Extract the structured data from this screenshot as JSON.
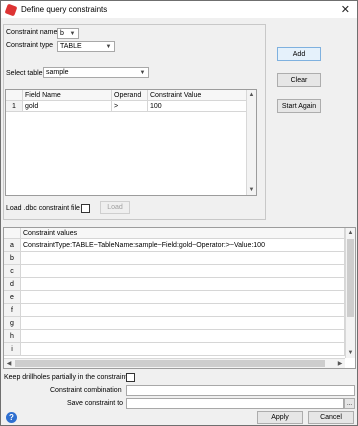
{
  "window": {
    "title": "Define query constraints",
    "close_glyph": "✕"
  },
  "constraint": {
    "name_label": "Constraint name",
    "name_value": "b",
    "type_label": "Constraint type",
    "type_value": "TABLE",
    "select_table_label": "Select table",
    "select_table_value": "sample"
  },
  "field_grid": {
    "headers": [
      "Field Name",
      "Operand",
      "Constraint Value"
    ],
    "rows": [
      {
        "num": "1",
        "field": "gold",
        "operand": ">",
        "value": "100"
      }
    ]
  },
  "dbc": {
    "label": "Load .dbc constraint file",
    "load_button": "Load"
  },
  "side_buttons": {
    "add": "Add",
    "clear": "Clear",
    "start_again": "Start Again"
  },
  "values_grid": {
    "header": "Constraint values",
    "rows": [
      {
        "key": "a",
        "value": "ConstraintType:TABLE~TableName:sample~Field:gold~Operator:>~Value:100"
      },
      {
        "key": "b",
        "value": ""
      },
      {
        "key": "c",
        "value": ""
      },
      {
        "key": "d",
        "value": ""
      },
      {
        "key": "e",
        "value": ""
      },
      {
        "key": "f",
        "value": ""
      },
      {
        "key": "g",
        "value": ""
      },
      {
        "key": "h",
        "value": ""
      },
      {
        "key": "i",
        "value": ""
      }
    ]
  },
  "options": {
    "keep_drillholes_label": "Keep drillholes partially in the constraint",
    "combination_label": "Constraint combination",
    "combination_value": "",
    "save_label": "Save constraint to",
    "save_value": "",
    "browse_glyph": "..."
  },
  "footer": {
    "help_glyph": "?",
    "apply": "Apply",
    "cancel": "Cancel"
  },
  "icons": {
    "app": "query-app-icon",
    "help": "help-icon"
  },
  "colors": {
    "primary_border": "#7fb1df",
    "help_blue": "#2e6fd0"
  }
}
